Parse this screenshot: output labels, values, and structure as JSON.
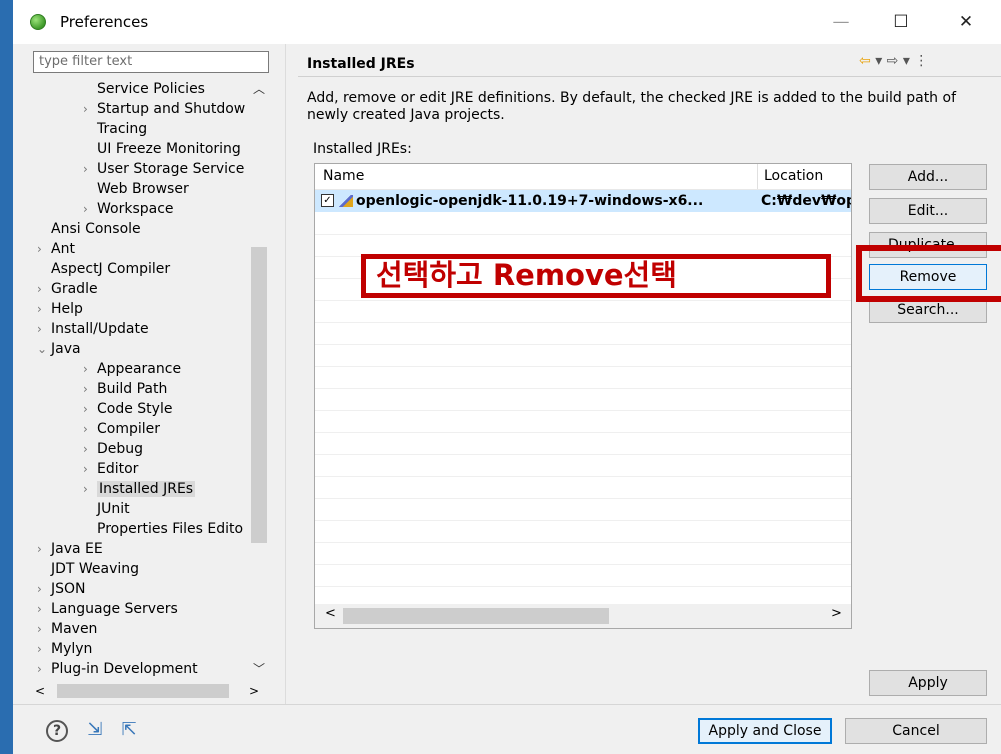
{
  "window": {
    "title": "Preferences",
    "minimize": "—",
    "maximize": "☐",
    "close": "✕"
  },
  "sidebar": {
    "filter_placeholder": "type filter text",
    "items": [
      {
        "label": "Service Policies",
        "twisty": ""
      },
      {
        "label": "Startup and Shutdow",
        "twisty": ">"
      },
      {
        "label": "Tracing",
        "twisty": ""
      },
      {
        "label": "UI Freeze Monitoring",
        "twisty": ""
      },
      {
        "label": "User Storage Service",
        "twisty": ">"
      },
      {
        "label": "Web Browser",
        "twisty": ""
      },
      {
        "label": "Workspace",
        "twisty": ">"
      },
      {
        "label": "Ansi Console",
        "twisty": ""
      },
      {
        "label": "Ant",
        "twisty": ">"
      },
      {
        "label": "AspectJ Compiler",
        "twisty": ""
      },
      {
        "label": "Gradle",
        "twisty": ">"
      },
      {
        "label": "Help",
        "twisty": ">"
      },
      {
        "label": "Install/Update",
        "twisty": ">"
      },
      {
        "label": "Java",
        "twisty": "v"
      },
      {
        "label": "Appearance",
        "twisty": ">"
      },
      {
        "label": "Build Path",
        "twisty": ">"
      },
      {
        "label": "Code Style",
        "twisty": ">"
      },
      {
        "label": "Compiler",
        "twisty": ">"
      },
      {
        "label": "Debug",
        "twisty": ">"
      },
      {
        "label": "Editor",
        "twisty": ">"
      },
      {
        "label": "Installed JREs",
        "twisty": ">"
      },
      {
        "label": "JUnit",
        "twisty": ""
      },
      {
        "label": "Properties Files Edito",
        "twisty": ""
      },
      {
        "label": "Java EE",
        "twisty": ">"
      },
      {
        "label": "JDT Weaving",
        "twisty": ""
      },
      {
        "label": "JSON",
        "twisty": ">"
      },
      {
        "label": "Language Servers",
        "twisty": ">"
      },
      {
        "label": "Maven",
        "twisty": ">"
      },
      {
        "label": "Mylyn",
        "twisty": ">"
      },
      {
        "label": "Plug-in Development",
        "twisty": ">"
      }
    ]
  },
  "main": {
    "title": "Installed JREs",
    "description": "Add, remove or edit JRE definitions. By default, the checked JRE is added to the build path of newly created Java projects.",
    "list_label": "Installed JREs:",
    "columns": [
      "Name",
      "Location"
    ],
    "rows": [
      {
        "name": "openlogic-openjdk-11.0.19+7-windows-x6...",
        "location": "C:₩dev₩openlogic",
        "checked": true
      }
    ],
    "buttons": {
      "add": "Add...",
      "edit": "Edit...",
      "duplicate": "Duplicate...",
      "remove": "Remove",
      "search": "Search...",
      "apply": "Apply"
    }
  },
  "annotation": {
    "callout_text": "선택하고 Remove선택",
    "color": "#c00000"
  },
  "footer": {
    "apply_close": "Apply and Close",
    "cancel": "Cancel"
  }
}
